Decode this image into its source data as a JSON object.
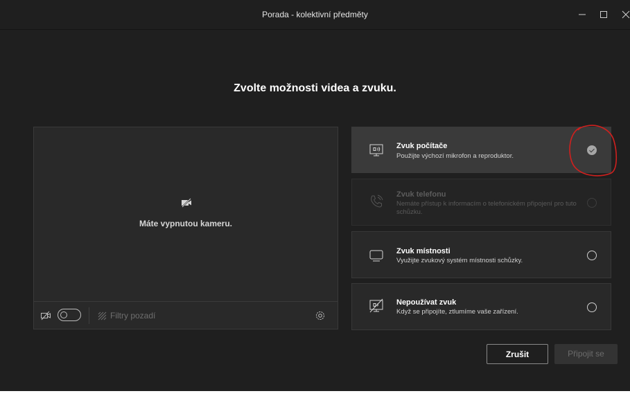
{
  "window": {
    "title": "Porada - kolektivní předměty",
    "controls": [
      "minimize-icon",
      "maximize-icon",
      "close-icon"
    ]
  },
  "heading": "Zvolte možnosti videa a zvuku.",
  "preview": {
    "camera_off_text": "Máte vypnutou kameru.",
    "camera_toggle_on": false,
    "background_filters_label": "Filtry pozadí"
  },
  "audio_options": [
    {
      "title": "Zvuk počítače",
      "description": "Použijte výchozí mikrofon a reproduktor.",
      "icon": "computer-speaker-icon",
      "selected": true,
      "disabled": false
    },
    {
      "title": "Zvuk telefonu",
      "description": "Nemáte přístup k informacím o telefonickém připojení pro tuto schůzku.",
      "icon": "phone-icon",
      "selected": false,
      "disabled": true
    },
    {
      "title": "Zvuk místnosti",
      "description": "Využijte zvukový systém místnosti schůzky.",
      "icon": "room-display-icon",
      "selected": false,
      "disabled": false
    },
    {
      "title": "Nepoužívat zvuk",
      "description": "Když se připojíte, ztlumíme vaše zařízení.",
      "icon": "no-audio-icon",
      "selected": false,
      "disabled": false
    }
  ],
  "buttons": {
    "cancel": "Zrušit",
    "join": "Připojit se"
  },
  "colors": {
    "background": "#1f1f1f",
    "panel": "#292929",
    "selected_option": "#3a3a3a",
    "annotation": "#d0201e"
  }
}
